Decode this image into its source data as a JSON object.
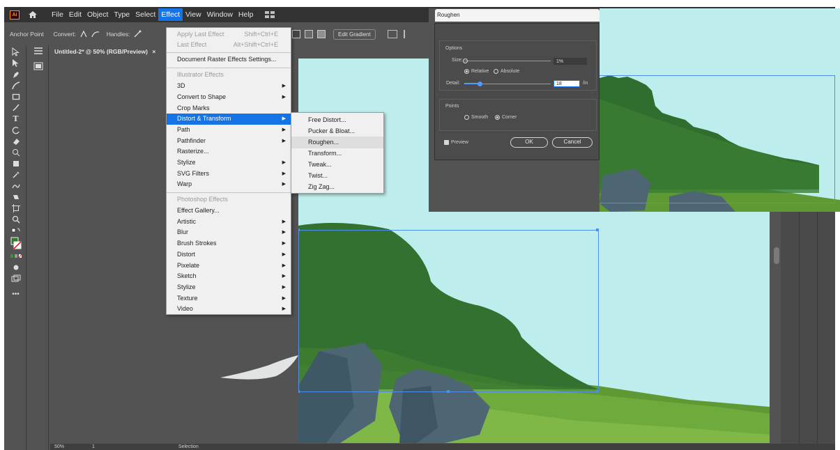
{
  "app": {
    "logo": "Ai",
    "menus": [
      "File",
      "Edit",
      "Object",
      "Type",
      "Select",
      "Effect",
      "View",
      "Window",
      "Help"
    ],
    "active_menu": "Effect"
  },
  "control_bar": {
    "anchor_point": "Anchor Point",
    "convert": "Convert:",
    "handles": "Handles:",
    "edit_gradient": "Edit Gradient"
  },
  "document": {
    "tab_title": "Untitled-2* @ 50% (RGB/Preview)",
    "close_glyph": "×"
  },
  "status": {
    "zoom": "50%",
    "page": "1",
    "tool": "Selection"
  },
  "effect_menu": {
    "apply_last": {
      "label": "Apply Last Effect",
      "shortcut": "Shift+Ctrl+E"
    },
    "last_effect": {
      "label": "Last Effect",
      "shortcut": "Alt+Shift+Ctrl+E"
    },
    "raster_settings": "Document Raster Effects Settings...",
    "illustrator_header": "Illustrator Effects",
    "illustrator_items": [
      "3D",
      "Convert to Shape",
      "Crop Marks",
      "Distort & Transform",
      "Path",
      "Pathfinder",
      "Rasterize...",
      "Stylize",
      "SVG Filters",
      "Warp"
    ],
    "photoshop_header": "Photoshop Effects",
    "photoshop_items": [
      "Effect Gallery...",
      "Artistic",
      "Blur",
      "Brush Strokes",
      "Distort",
      "Pixelate",
      "Sketch",
      "Stylize",
      "Texture",
      "Video"
    ],
    "highlighted": "Distort & Transform"
  },
  "submenu": {
    "items": [
      "Free Distort...",
      "Pucker & Bloat...",
      "Roughen...",
      "Transform...",
      "Tweak...",
      "Twist...",
      "Zig Zag..."
    ],
    "hovered": "Roughen..."
  },
  "roughen_dialog": {
    "title": "Roughen",
    "options_label": "Options",
    "size_label": "Size:",
    "size_value": "1%",
    "relative": "Relative",
    "absolute": "Absolute",
    "detail_label": "Detail:",
    "detail_value": "18",
    "detail_unit": "/in",
    "points_label": "Points",
    "smooth": "Smooth",
    "corner": "Corner",
    "preview": "Preview",
    "ok": "OK",
    "cancel": "Cancel",
    "size_fraction": 0.01,
    "detail_fraction": 0.18
  },
  "colors": {
    "sky": "#bdeeed",
    "forest": "#2f6e2f",
    "grass": "#6aa03a",
    "rock": "#4f6676",
    "accent": "#1473e6"
  }
}
